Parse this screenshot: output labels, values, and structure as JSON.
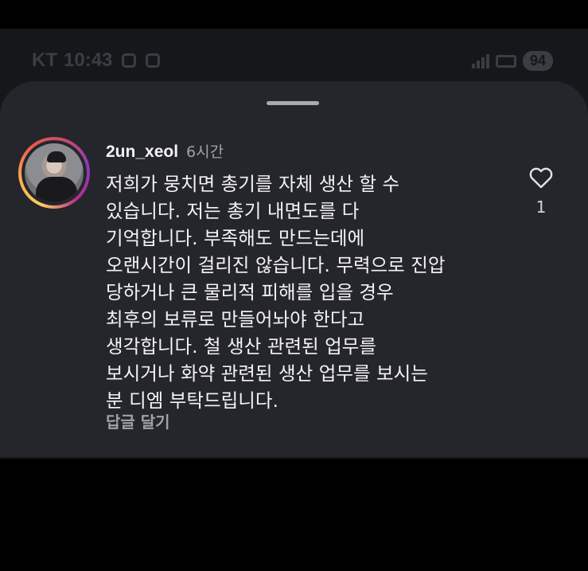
{
  "status_bar": {
    "carrier": "KT",
    "time": "10:43",
    "battery": "94"
  },
  "comment": {
    "username": "2un_xeol",
    "timestamp": "6시간",
    "text": "저희가 뭉치면 총기를 자체 생산 할 수\n있습니다. 저는 총기 내면도를 다\n기억합니다. 부족해도 만드는데에\n오랜시간이 걸리진 않습니다. 무력으로 진압\n당하거나 큰 물리적 피해를 입을 경우\n최후의 보류로 만들어놔야 한다고\n생각합니다. 철 생산 관련된 업무를\n보시거나 화약 관련된 생산 업무를 보시는\n분 디엠 부탁드립니다.",
    "like_count": "1",
    "reply_label": "답글 달기",
    "like_icon": "heart-outline-icon"
  },
  "colors": {
    "sheet_background": "#25262b",
    "text_primary": "#f3f3f5",
    "text_secondary": "#a0a2a8"
  }
}
